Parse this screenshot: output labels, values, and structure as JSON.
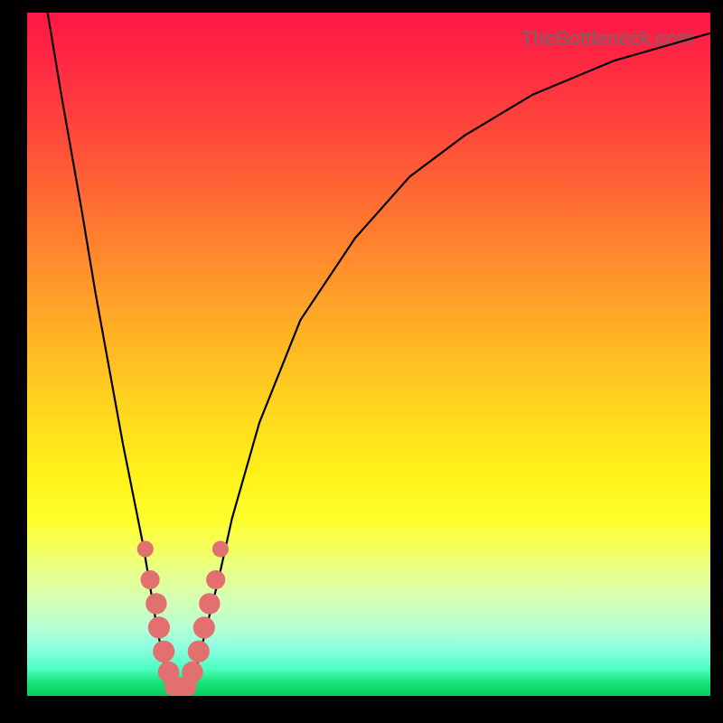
{
  "watermark": "TheBottleneck.com",
  "colors": {
    "dot": "#e2706e",
    "curve": "#000000",
    "frame": "#000000"
  },
  "chart_data": {
    "type": "line",
    "title": "",
    "xlabel": "",
    "ylabel": "",
    "xlim": [
      0,
      100
    ],
    "ylim": [
      0,
      100
    ],
    "series": [
      {
        "name": "bottleneck-curve",
        "x": [
          3,
          5,
          8,
          10,
          12,
          14,
          16,
          17,
          18,
          19,
          20,
          21,
          22,
          23,
          24,
          25,
          26,
          28,
          30,
          34,
          40,
          48,
          56,
          64,
          74,
          86,
          100
        ],
        "values": [
          100,
          88,
          71,
          59,
          48,
          37,
          27,
          22,
          16,
          10,
          5,
          2,
          0.6,
          0.6,
          2,
          5,
          9,
          17,
          26,
          40,
          55,
          67,
          76,
          82,
          88,
          93,
          97
        ]
      }
    ],
    "markers": {
      "name": "highlight-dots",
      "points": [
        {
          "x": 17.3,
          "y": 21.5,
          "r": 1.2
        },
        {
          "x": 18.0,
          "y": 17.0,
          "r": 1.4
        },
        {
          "x": 18.9,
          "y": 13.5,
          "r": 1.55
        },
        {
          "x": 19.3,
          "y": 10.0,
          "r": 1.6
        },
        {
          "x": 20.0,
          "y": 6.5,
          "r": 1.6
        },
        {
          "x": 20.7,
          "y": 3.5,
          "r": 1.55
        },
        {
          "x": 21.6,
          "y": 1.4,
          "r": 1.5
        },
        {
          "x": 22.5,
          "y": 0.6,
          "r": 1.5
        },
        {
          "x": 23.3,
          "y": 1.4,
          "r": 1.5
        },
        {
          "x": 24.2,
          "y": 3.5,
          "r": 1.55
        },
        {
          "x": 25.1,
          "y": 6.5,
          "r": 1.6
        },
        {
          "x": 25.9,
          "y": 10.0,
          "r": 1.6
        },
        {
          "x": 26.7,
          "y": 13.5,
          "r": 1.55
        },
        {
          "x": 27.6,
          "y": 17.0,
          "r": 1.4
        },
        {
          "x": 28.3,
          "y": 21.5,
          "r": 1.2
        }
      ]
    }
  }
}
